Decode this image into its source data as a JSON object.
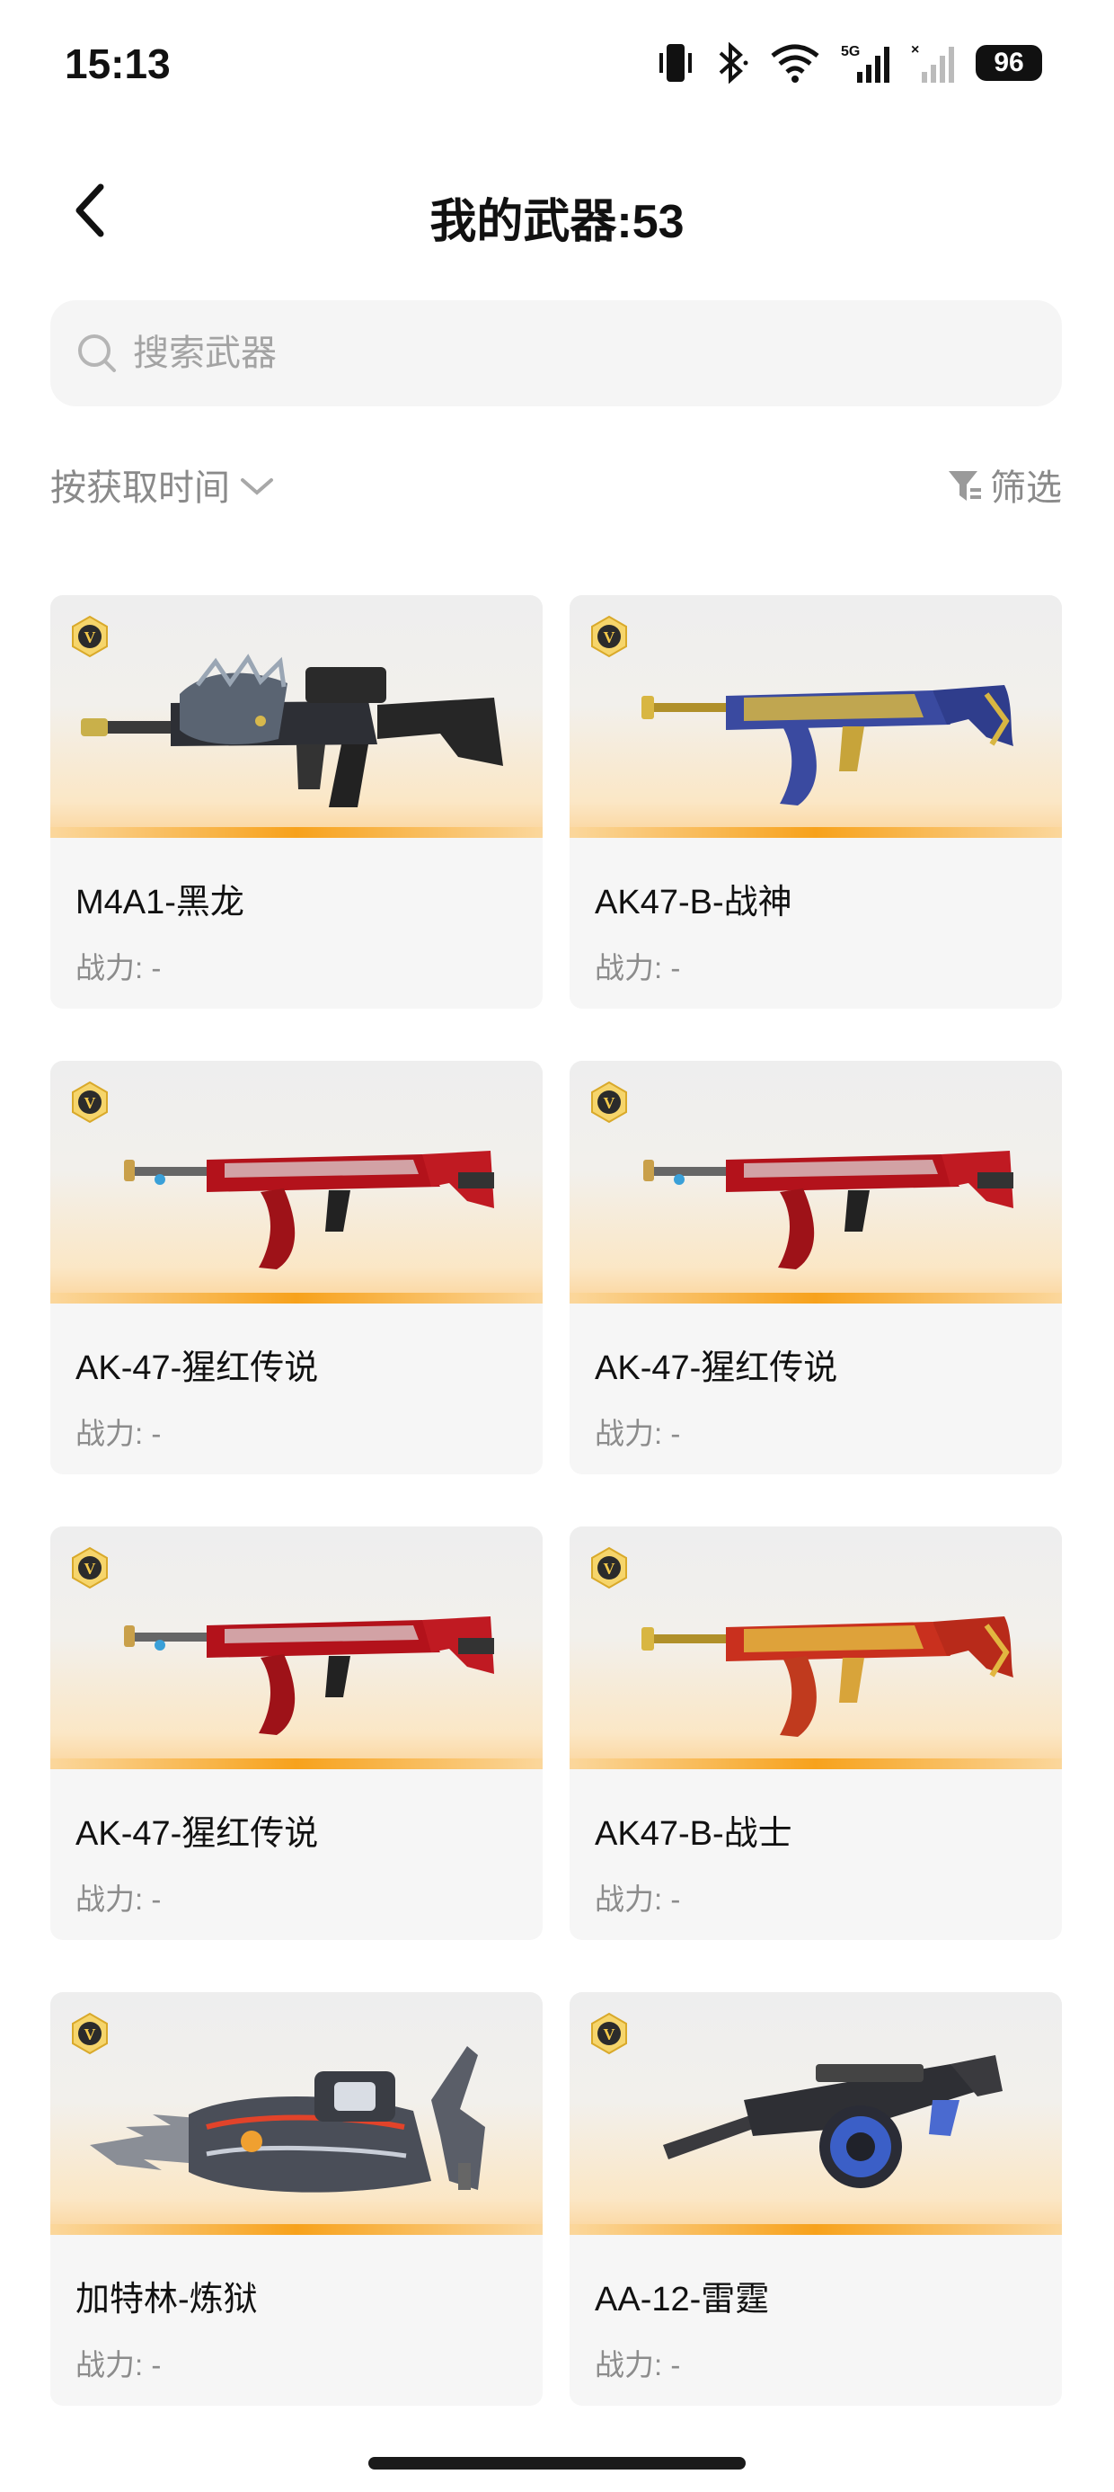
{
  "status_bar": {
    "time": "15:13",
    "battery": "96",
    "network": "5G"
  },
  "header": {
    "title": "我的武器:53"
  },
  "search": {
    "placeholder": "搜索武器"
  },
  "sort": {
    "label": "按获取时间"
  },
  "filter": {
    "label": "筛选"
  },
  "colors": {
    "accent": "#f7a21c",
    "card_bg": "#f6f6f6",
    "muted_text": "#8c8c8c"
  },
  "weapons": [
    {
      "name": "M4A1-黑龙",
      "power": "战力: -",
      "icon": "m4a1-black-dragon-icon"
    },
    {
      "name": "AK47-B-战神",
      "power": "战力: -",
      "icon": "ak47-b-god-of-war-icon"
    },
    {
      "name": "AK-47-猩红传说",
      "power": "战力: -",
      "icon": "ak47-scarlet-legend-icon"
    },
    {
      "name": "AK-47-猩红传说",
      "power": "战力: -",
      "icon": "ak47-scarlet-legend-icon"
    },
    {
      "name": "AK-47-猩红传说",
      "power": "战力: -",
      "icon": "ak47-scarlet-legend-icon"
    },
    {
      "name": "AK47-B-战士",
      "power": "战力: -",
      "icon": "ak47-b-warrior-icon"
    },
    {
      "name": "加特林-炼狱",
      "power": "战力: -",
      "icon": "gatling-purgatory-icon"
    },
    {
      "name": "AA-12-雷霆",
      "power": "战力: -",
      "icon": "aa12-thunder-icon"
    }
  ]
}
